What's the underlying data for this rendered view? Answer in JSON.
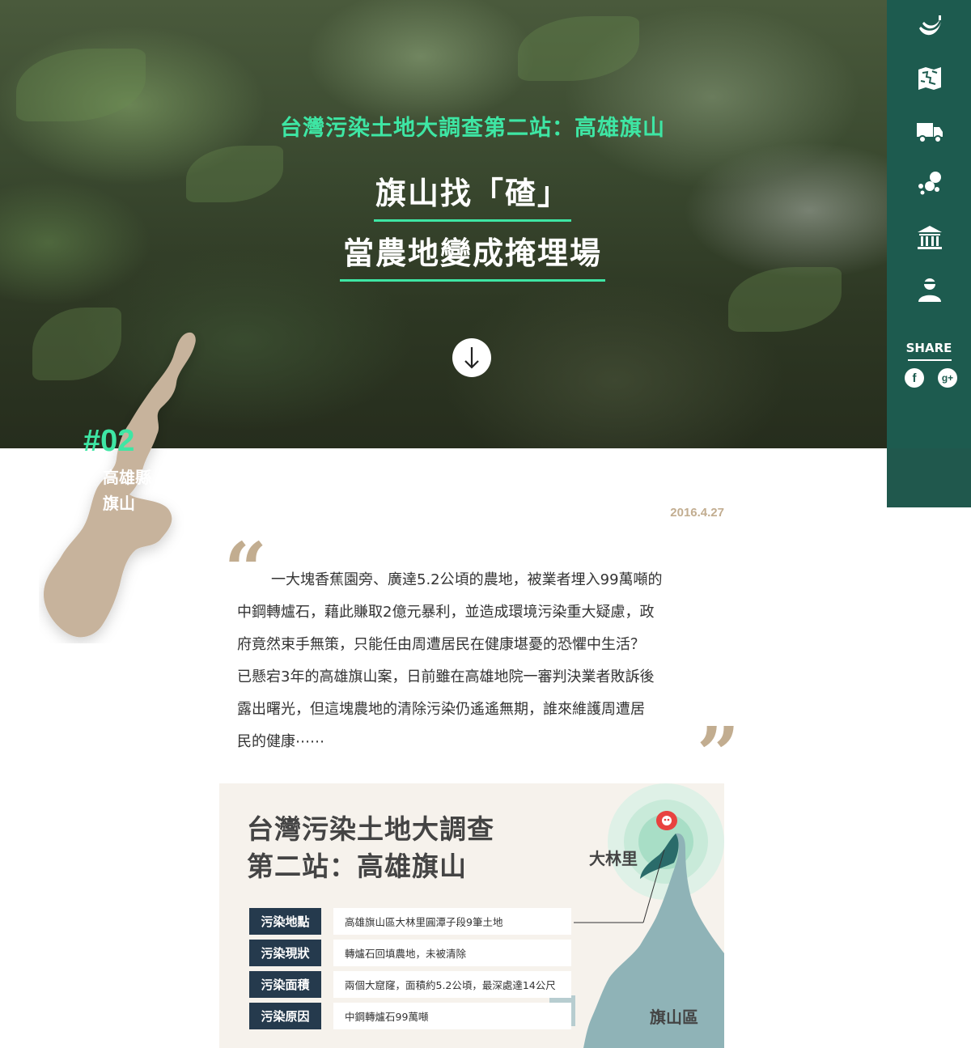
{
  "hero": {
    "subtitle": "台灣污染土地大調查第二站：高雄旗山",
    "title_line1": "旗山找「碴」",
    "title_line2": "當農地變成掩埋場"
  },
  "sidebar": {
    "icons": [
      "banana-icon",
      "map-icon",
      "truck-icon",
      "slag-icon",
      "government-icon",
      "person-icon"
    ],
    "share_label": "SHARE",
    "facebook_glyph": "f",
    "googleplus_glyph": "g+"
  },
  "location": {
    "number": "#02",
    "county": "高雄縣",
    "town": "旗山"
  },
  "article": {
    "date": "2016.4.27",
    "quote_open": "“",
    "quote_close": "”",
    "quote_lines": [
      "一大塊香蕉園旁、廣達5.2公頃的農地，被業者埋入99萬噸的",
      "中鋼轉爐石，藉此賺取2億元暴利，並造成環境污染重大疑慮，政",
      "府竟然束手無策，只能任由周遭居民在健康堪憂的恐懼中生活？",
      "已懸宕3年的高雄旗山案，日前雖在高雄地院一審判決業者敗訴後",
      "露出曙光，但這塊農地的清除污染仍遙遙無期，誰來維護周遭居",
      "民的健康⋯⋯"
    ]
  },
  "infographic": {
    "title_line1": "台灣污染土地大調查",
    "title_line2": "第二站：高雄旗山",
    "rows": [
      {
        "label": "污染地點",
        "value": "高雄旗山區大林里圓潭子段9筆土地"
      },
      {
        "label": "污染現狀",
        "value": "轉爐石回填農地，未被清除"
      },
      {
        "label": "污染面積",
        "value": "兩個大窟窿，面積約5.2公頃，最深處達14公尺"
      },
      {
        "label": "污染原因",
        "value": "中鋼轉爐石99萬噸"
      }
    ],
    "map_labels": {
      "village": "大林里",
      "district": "旗山區"
    },
    "colors": {
      "accent": "#3ee6a4",
      "sidebar": "#1d5b4f",
      "label_bg": "#253a4d",
      "tan": "#c2ad90",
      "pin": "#e8423f"
    }
  }
}
